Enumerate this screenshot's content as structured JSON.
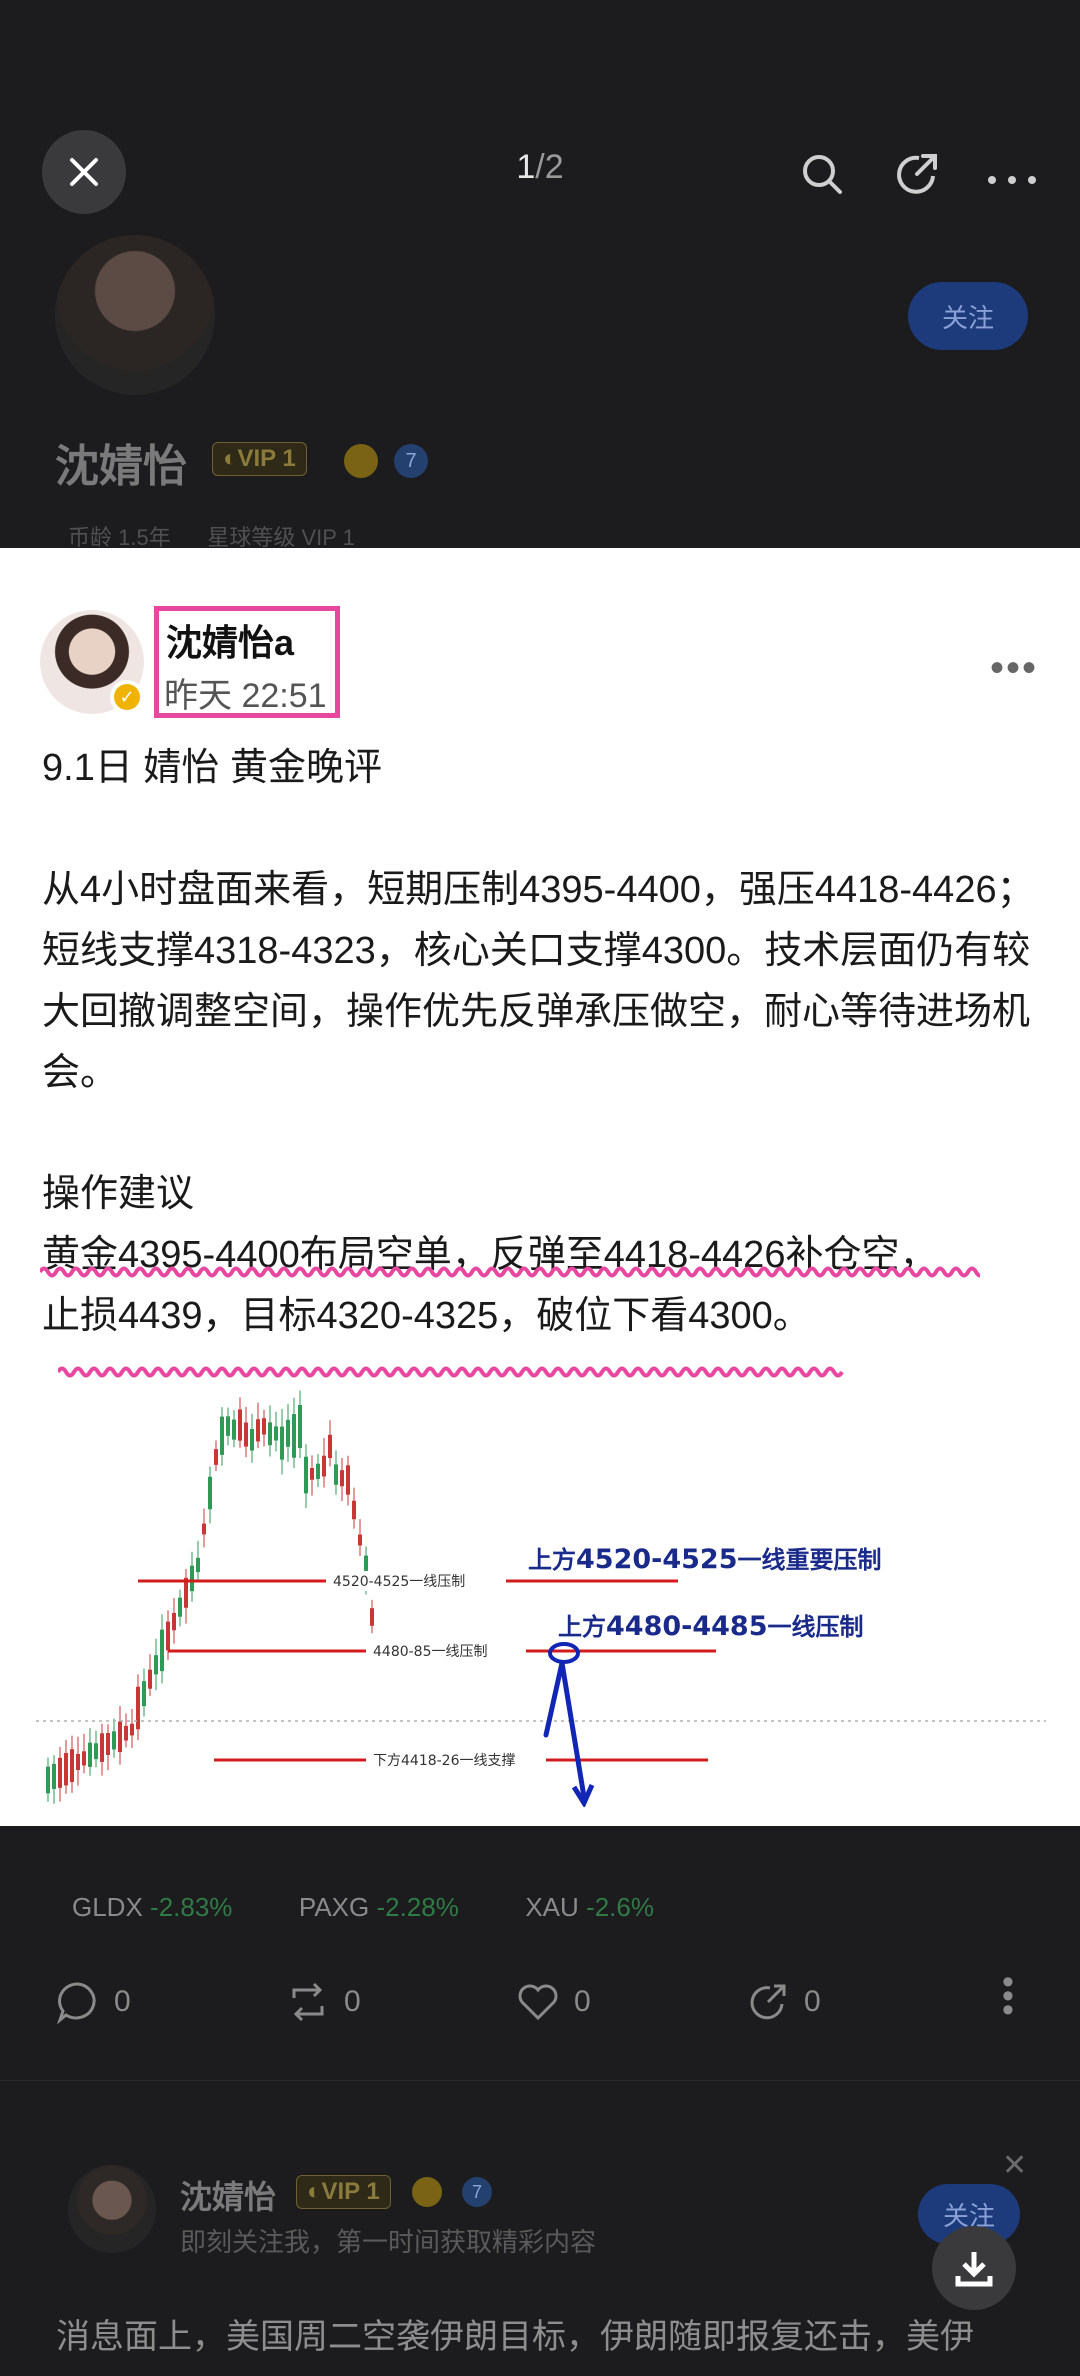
{
  "viewer": {
    "pager_current": "1",
    "pager_sep": "/",
    "pager_total": "2"
  },
  "icons": {
    "close": "close-icon",
    "search": "search-icon",
    "share": "share-icon",
    "more": "more-icon",
    "download": "download-icon"
  },
  "background_profile": {
    "name": "沈婧怡",
    "vip": "VIP 1",
    "badge": "7",
    "follow": "关注",
    "sub_left": "币龄 1.5年",
    "sub_right": "星球等级 VIP 1"
  },
  "post": {
    "author": "沈婧怡a",
    "time": "昨天 22:51",
    "title": "9.1日 婧怡  黄金晚评",
    "paragraph1": "从4小时盘面来看，短期压制4395-4400，强压4418-4426；短线支撑4318-4323，核心关口支撑4300。技术层面仍有较大回撤调整空间，操作优先反弹承压做空，耐心等待进场机会。",
    "advice_heading": "操作建议",
    "advice_line1": "黄金4395-4400布局空单，反弹至4418-4426补仓空，",
    "advice_line2": "止损4439，目标4320-4325，破位下看4300。"
  },
  "chart_data": {
    "type": "candlestick",
    "levels": [
      {
        "label": "4520-4525一线压制",
        "annotation_prefix": "上方",
        "annotation_value": "4520-4525",
        "annotation_suffix": "一线重要压制"
      },
      {
        "label": "4480-85一线压制",
        "annotation_prefix": "上方",
        "annotation_value": "4480-4485",
        "annotation_suffix": "一线压制"
      },
      {
        "label": "下方4418-26一线支撑"
      }
    ],
    "colors": {
      "lines": "#d01c1c",
      "annotation": "#1a2a8a",
      "arrow": "#1226b5"
    }
  },
  "tickers": [
    {
      "symbol": "GLDX",
      "change": "-2.83%"
    },
    {
      "symbol": "PAXG",
      "change": "-2.28%"
    },
    {
      "symbol": "XAU",
      "change": "-2.6%"
    }
  ],
  "actions": {
    "comments": "0",
    "reposts": "0",
    "likes": "0",
    "shares": "0"
  },
  "next_post": {
    "name": "沈婧怡",
    "vip": "VIP 1",
    "badge": "7",
    "subtitle": "即刻关注我，第一时间获取精彩内容",
    "follow": "关注",
    "text": "消息面上，美国周二空袭伊朗目标，伊朗随即报复还击，美伊"
  },
  "colors": {
    "highlight": "#e8479f",
    "follow_bg": "#1d3a7a",
    "negative": "#2f7a45"
  }
}
